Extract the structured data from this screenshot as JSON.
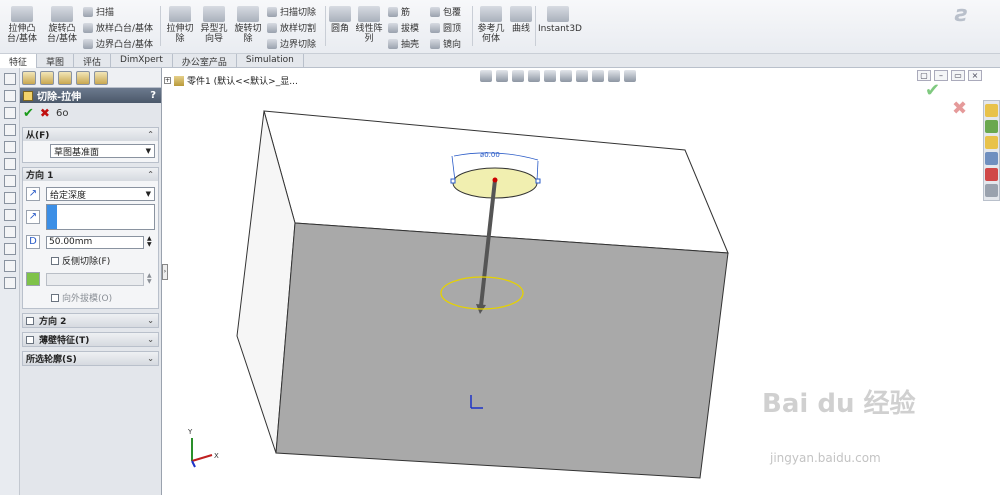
{
  "ribbon": {
    "extrude_boss": "拉伸凸\n台/基体",
    "revolve_boss": "旋转凸\n台/基体",
    "sweep": "扫描",
    "loft_boss": "放样凸台/基体",
    "boundary_boss": "边界凸台/基体",
    "extrude_cut": "拉伸切\n除",
    "hole_wizard": "异型孔\n向导",
    "revolve_cut": "旋转切\n除",
    "swept_cut": "扫描切除",
    "lofted_cut": "放样切割",
    "boundary_cut": "边界切除",
    "fillet": "圆角",
    "linear_pattern": "线性阵\n列",
    "rib": "筋",
    "draft": "拔模",
    "shell": "抽壳",
    "wrap": "包覆",
    "dome": "圆顶",
    "mirror": "镜向",
    "ref_geometry": "参考几\n何体",
    "curves": "曲线",
    "instant3d": "Instant3D"
  },
  "tabs": [
    "特征",
    "草图",
    "评估",
    "DimXpert",
    "办公室产品",
    "Simulation"
  ],
  "active_tab": "特征",
  "pm": {
    "title": "切除-拉伸",
    "help": "?",
    "from_header": "从(F)",
    "from_value": "草图基准面",
    "dir1_header": "方向 1",
    "end_condition": "给定深度",
    "depth": "50.00mm",
    "flip_side": "反侧切除(F)",
    "draft_outward": "向外拔模(O)",
    "dir2_header": "方向 2",
    "thin_header": "薄壁特征(T)",
    "contours_header": "所选轮廓(S)"
  },
  "gfx": {
    "tree_label": "零件1 (默认<<默认>_显...",
    "dim_label": "⌀0.00"
  },
  "watermark": {
    "main": "Bai du 经验",
    "url": "jingyan.baidu.com"
  },
  "colors": {
    "accent": "#3c8fe6",
    "ok": "#1a9a1a",
    "cancel": "#c01010",
    "sketch_yellow": "#f1efb0"
  }
}
